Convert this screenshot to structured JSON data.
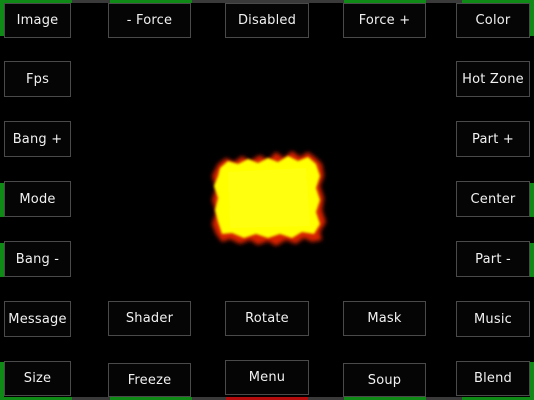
{
  "buttons": {
    "image": "Image",
    "minus_force": "- Force",
    "disabled": "Disabled",
    "force_plus": "Force +",
    "color": "Color",
    "fps": "Fps",
    "hot_zone": "Hot Zone",
    "bang_plus": "Bang +",
    "part_plus": "Part +",
    "mode": "Mode",
    "center": "Center",
    "bang_minus": "Bang -",
    "part_minus": "Part -",
    "message": "Message",
    "shader": "Shader",
    "rotate": "Rotate",
    "mask": "Mask",
    "music": "Music",
    "size": "Size",
    "freeze": "Freeze",
    "menu": "Menu",
    "soup": "Soup",
    "blend": "Blend"
  },
  "colors": {
    "background": "#000000",
    "edge_indicator": "#0f8a16",
    "edge_indicator_active": "#b40c0c",
    "fire_core": "#ffff00",
    "fire_edge": "#e02a00"
  }
}
